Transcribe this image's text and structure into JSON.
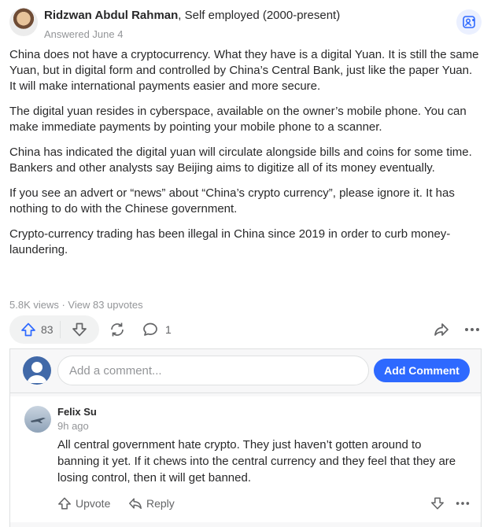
{
  "answer": {
    "author": "Ridzwan Abdul Rahman",
    "credential": ", Self employed (2000-present)",
    "answered": "Answered June 4",
    "paragraphs": [
      "China does not have a cryptocurrency. What they have is a digital Yuan. It is still the same Yuan, but in digital form and controlled by China’s Central Bank, just like the paper Yuan. It will make international payments easier and more secure.",
      "The digital yuan resides in cyberspace, available on the owner’s mobile phone. You can make immediate payments by pointing your mobile phone to a scanner.",
      "China has indicated the digital yuan will circulate alongside bills and coins for some time. Bankers and other analysts say Beijing aims to digitize all of its money eventually.",
      "If you see an advert or “news” about “China’s crypto currency”, please ignore it. It has nothing to do with the Chinese government.",
      "Crypto-currency trading has been illegal in China since 2019 in order to curb money-laundering."
    ],
    "stats": "5.8K views · View 83 upvotes",
    "upvotes": "83",
    "comments": "1"
  },
  "comment_box": {
    "placeholder": "Add a comment...",
    "button_label": "Add Comment"
  },
  "comment": {
    "author": "Felix Su",
    "time": "9h ago",
    "text": "All central government hate crypto. They just haven’t gotten around to banning it yet. If it chews into the central currency and they feel that they are losing control, then it will get banned.",
    "upvote_label": "Upvote",
    "reply_label": "Reply"
  },
  "colors": {
    "accent": "#2e69ff",
    "text": "#282829",
    "muted": "#939598"
  }
}
